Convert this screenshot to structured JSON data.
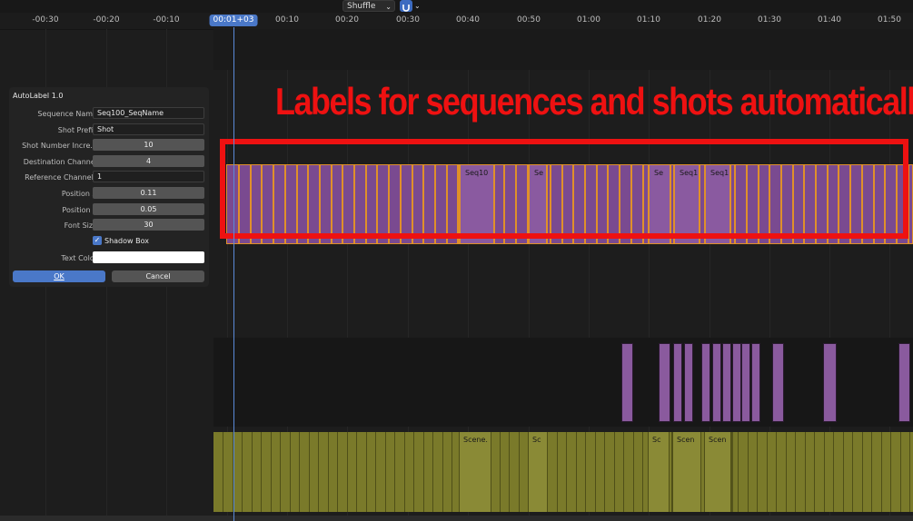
{
  "header": {
    "shuffle_label": "Shuffle",
    "snap_icon": "snap-magnet-icon"
  },
  "ruler": {
    "ticks": [
      "-00:30",
      "-00:20",
      "-00:10",
      "00:10",
      "00:20",
      "00:30",
      "00:40",
      "00:50",
      "01:00",
      "01:10",
      "01:20",
      "01:30",
      "01:40",
      "01:50"
    ],
    "playhead": "00:01+03"
  },
  "banner": {
    "text": "Labels for sequences and shots automatically!"
  },
  "dialog": {
    "title": "AutoLabel 1.0",
    "fields": [
      {
        "label": "Sequence Name",
        "value": "Seq100_SeqName",
        "kind": "text"
      },
      {
        "label": "Shot Prefix",
        "value": "Shot",
        "kind": "text"
      },
      {
        "label": "Shot Number Incre...",
        "value": "10",
        "kind": "number"
      },
      {
        "label": "Destination Channel",
        "value": "4",
        "kind": "number"
      },
      {
        "label": "Reference Channels",
        "value": "1",
        "kind": "text"
      },
      {
        "label": "Position X",
        "value": "0.11",
        "kind": "number"
      },
      {
        "label": "Position Y",
        "value": "0.05",
        "kind": "number"
      },
      {
        "label": "Font Size",
        "value": "30",
        "kind": "number"
      }
    ],
    "shadow_box": {
      "label": "Shadow Box",
      "checked": true
    },
    "text_color": {
      "label": "Text Color",
      "value": "#ffffff"
    },
    "ok_label": "OK",
    "cancel_label": "Cancel"
  },
  "strip_labels": {
    "top": [
      "Seq10",
      "Se",
      "Se",
      "Seq1",
      "Seq1"
    ],
    "bottom": [
      "Scene.",
      "Sc",
      "Sc",
      "Scen",
      "Scen"
    ]
  },
  "colors": {
    "accent": "#4a78c8",
    "highlight_red": "#ee1111",
    "purple_strip": "#7a4a90",
    "yellow_strip": "#7a7a2a"
  }
}
